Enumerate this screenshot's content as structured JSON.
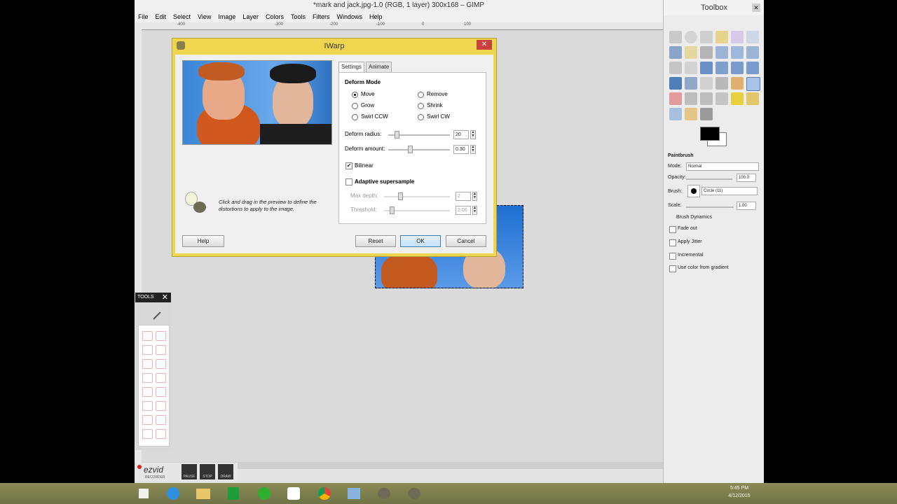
{
  "gimp": {
    "title": "*mark and jack.jpg-1.0 (RGB, 1 layer) 300x168 – GIMP",
    "menu": [
      "File",
      "Edit",
      "Select",
      "View",
      "Image",
      "Layer",
      "Colors",
      "Tools",
      "Filters",
      "Windows",
      "Help"
    ],
    "ruler_ticks": [
      "-400",
      "-300",
      "-200",
      "-100",
      "0",
      "100"
    ]
  },
  "toolbox": {
    "title": "Toolbox",
    "options_title": "Paintbrush",
    "mode_label": "Mode:",
    "mode_value": "Normal",
    "opacity_label": "Opacity:",
    "opacity_value": "100.0",
    "brush_label": "Brush:",
    "brush_value": "Circle (11)",
    "scale_label": "Scale:",
    "scale_value": "1.00",
    "brush_dynamics": "Brush Dynamics",
    "fade_out": "Fade out",
    "apply_jitter": "Apply Jitter",
    "incremental": "Incremental",
    "use_gradient": "Use color from gradient"
  },
  "dialog": {
    "title": "IWarp",
    "tabs": [
      "Settings",
      "Animate"
    ],
    "deform_mode_heading": "Deform Mode",
    "modes": [
      "Move",
      "Remove",
      "Grow",
      "Shrink",
      "Swirl CCW",
      "Swirl CW"
    ],
    "selected_mode": "Move",
    "deform_radius_label": "Deform radius:",
    "deform_radius_value": "20",
    "deform_amount_label": "Deform amount:",
    "deform_amount_value": "0.30",
    "bilinear_label": "Bilinear",
    "bilinear_checked": true,
    "adaptive_label": "Adaptive supersample",
    "adaptive_checked": false,
    "max_depth_label": "Max depth:",
    "max_depth_value": "2",
    "threshold_label": "Threshold:",
    "threshold_value": "2.00",
    "hint": "Click and drag in the preview to define the distortions to apply to the image.",
    "buttons": {
      "help": "Help",
      "reset": "Reset",
      "ok": "OK",
      "cancel": "Cancel"
    }
  },
  "ezvid": {
    "tools_label": "TOOLS",
    "close_glyph": "✕",
    "logo": "ezvid",
    "logo_sub": "RECORDER",
    "pause": "PAUSE",
    "stop": "STOP",
    "draw": "DRAW"
  },
  "taskbar": {
    "time": "5:45 PM",
    "date": "4/12/2015"
  },
  "colors": {
    "dialog_frame": "#f0d54f",
    "close_button": "#c9413a",
    "selection_blue": "#1e6fd1"
  }
}
